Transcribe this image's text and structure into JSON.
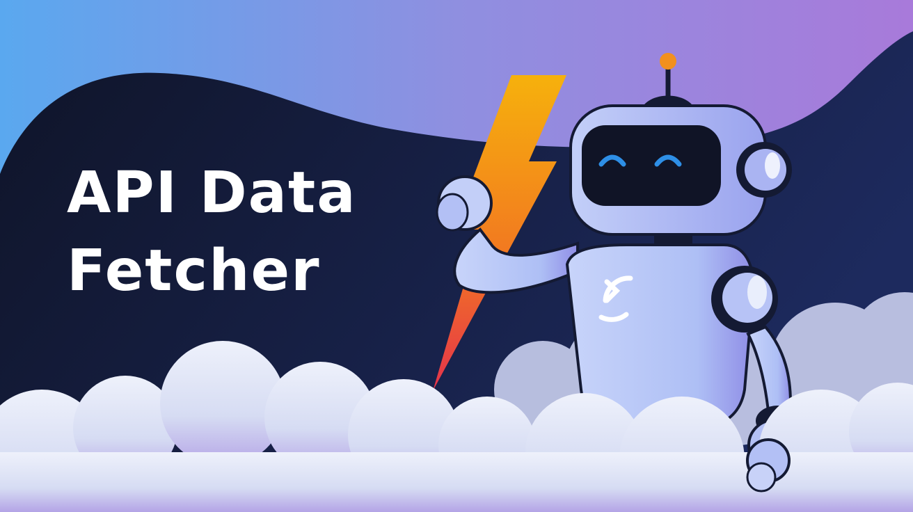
{
  "title": {
    "line1": "API Data",
    "line2": "Fetcher"
  },
  "illustration": {
    "subject": "robot-mascot",
    "icons": [
      "lightning-bolt-icon",
      "sync-arrows-icon",
      "antenna-icon"
    ]
  },
  "colors": {
    "background_top_left": "#5aa8ef",
    "background_top_right": "#a87ada",
    "dark_wave": "#141c38",
    "robot_body": "#b6c6f6",
    "robot_visor": "#101426",
    "robot_eyes": "#2e8fe6",
    "antenna_tip": "#f2901e",
    "bolt_top": "#f6b10c",
    "bolt_bottom": "#e5334b",
    "clouds": "#e1e6f6",
    "title_text": "#ffffff"
  }
}
